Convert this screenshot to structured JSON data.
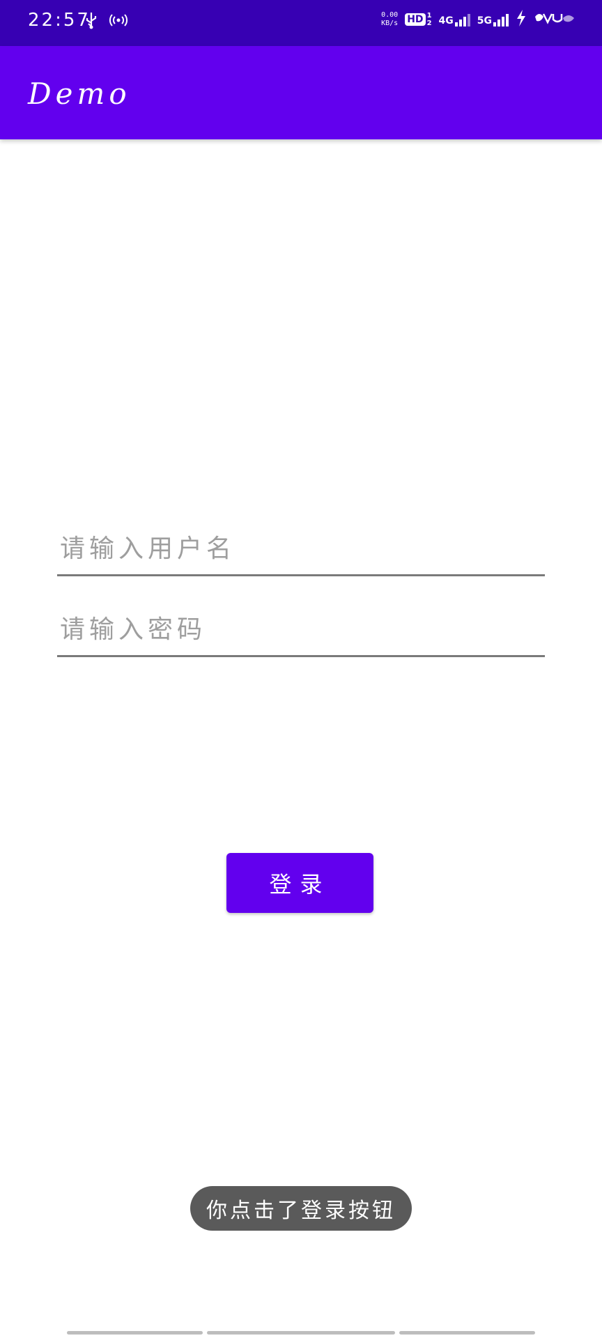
{
  "status_bar": {
    "time": "22:57",
    "net_speed_value": "0.00",
    "net_speed_unit": "KB/s",
    "hd_label": "HD",
    "hd_sub_top": "1",
    "hd_sub_bottom": "2",
    "net_type_1": "4G",
    "net_type_2": "5G",
    "background_color": "#3700B3"
  },
  "app_bar": {
    "title": "Demo",
    "background_color": "#6200EE"
  },
  "form": {
    "username_placeholder": "请输入用户名",
    "username_value": "",
    "password_placeholder": "请输入密码",
    "password_value": "",
    "login_button_label": "登录"
  },
  "toast": {
    "message": "你点击了登录按钮"
  }
}
